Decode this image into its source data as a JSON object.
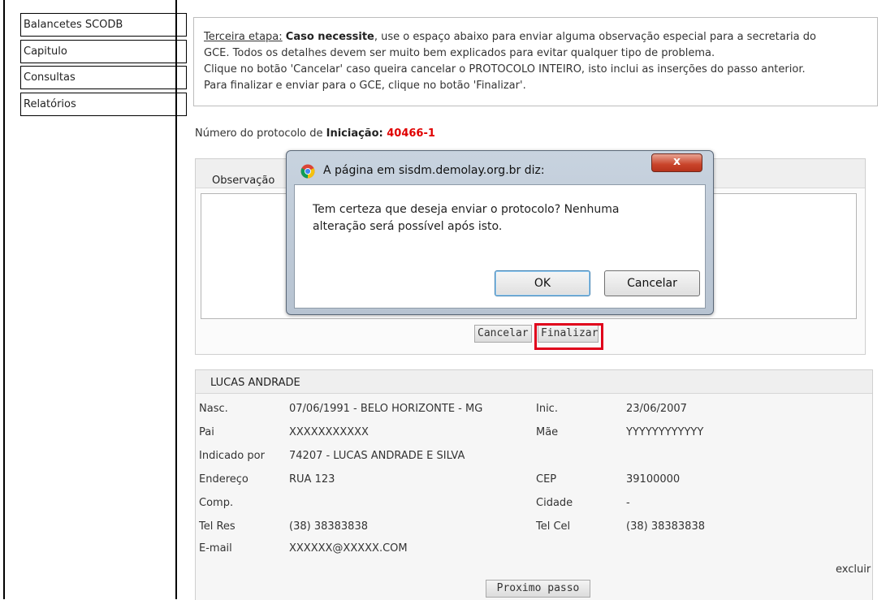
{
  "sidebar": {
    "items": [
      "Balancetes SCODB",
      "Capitulo",
      "Consultas",
      "Relatórios"
    ]
  },
  "info": {
    "step_label": "Terceira etapa:",
    "step_bold": "Caso necessite",
    "line1_rest": ", use o espaço abaixo para enviar alguma observação especial para a secretaria do",
    "line2": "GCE. Todos os detalhes devem ser muito bem explicados para evitar qualquer tipo de problema.",
    "line3": "Clique no botão 'Cancelar' caso queira cancelar o PROTOCOLO INTEIRO, isto inclui as inserções do passo anterior.",
    "line4": "Para finalizar e enviar para o GCE, clique no botão 'Finalizar'."
  },
  "protocol": {
    "prefix": "Número do protocolo de ",
    "type": "Iniciação",
    "sep": ": ",
    "number": "40466-1"
  },
  "observation": {
    "label": "Observação",
    "value": "",
    "cancel_label": "Cancelar",
    "finalize_label": "Finalizar"
  },
  "dialog": {
    "title": "A página em sisdm.demolay.org.br diz:",
    "close_symbol": "x",
    "message": "Tem certeza que deseja enviar o protocolo? Nenhuma alteração será possível após isto.",
    "ok_label": "OK",
    "cancel_label": "Cancelar"
  },
  "person": {
    "name": "LUCAS ANDRADE",
    "rows": [
      {
        "l1": "Nasc.",
        "v1": "07/06/1991 - BELO HORIZONTE - MG",
        "l2": "Inic.",
        "v2": "23/06/2007"
      },
      {
        "l1": "Pai",
        "v1": "XXXXXXXXXXX",
        "l2": "Mãe",
        "v2": "YYYYYYYYYYYY"
      },
      {
        "l1": "Indicado por",
        "v1": "74207 - LUCAS ANDRADE E SILVA",
        "l2": "",
        "v2": ""
      },
      {
        "l1": "Endereço",
        "v1": "RUA 123",
        "l2": "CEP",
        "v2": "39100000"
      },
      {
        "l1": "Comp.",
        "v1": "",
        "l2": "Cidade",
        "v2": "-"
      },
      {
        "l1": "Tel Res",
        "v1": "(38) 38383838",
        "l2": "Tel Cel",
        "v2": "(38) 38383838"
      },
      {
        "l1": "E-mail",
        "v1": "XXXXXX@XXXXX.COM",
        "l2": "",
        "v2": ""
      }
    ],
    "delete_label": "excluir",
    "next_label": "Proximo passo"
  },
  "colors": {
    "highlight_red": "#e0001b",
    "protocol_number": "#e00000"
  }
}
